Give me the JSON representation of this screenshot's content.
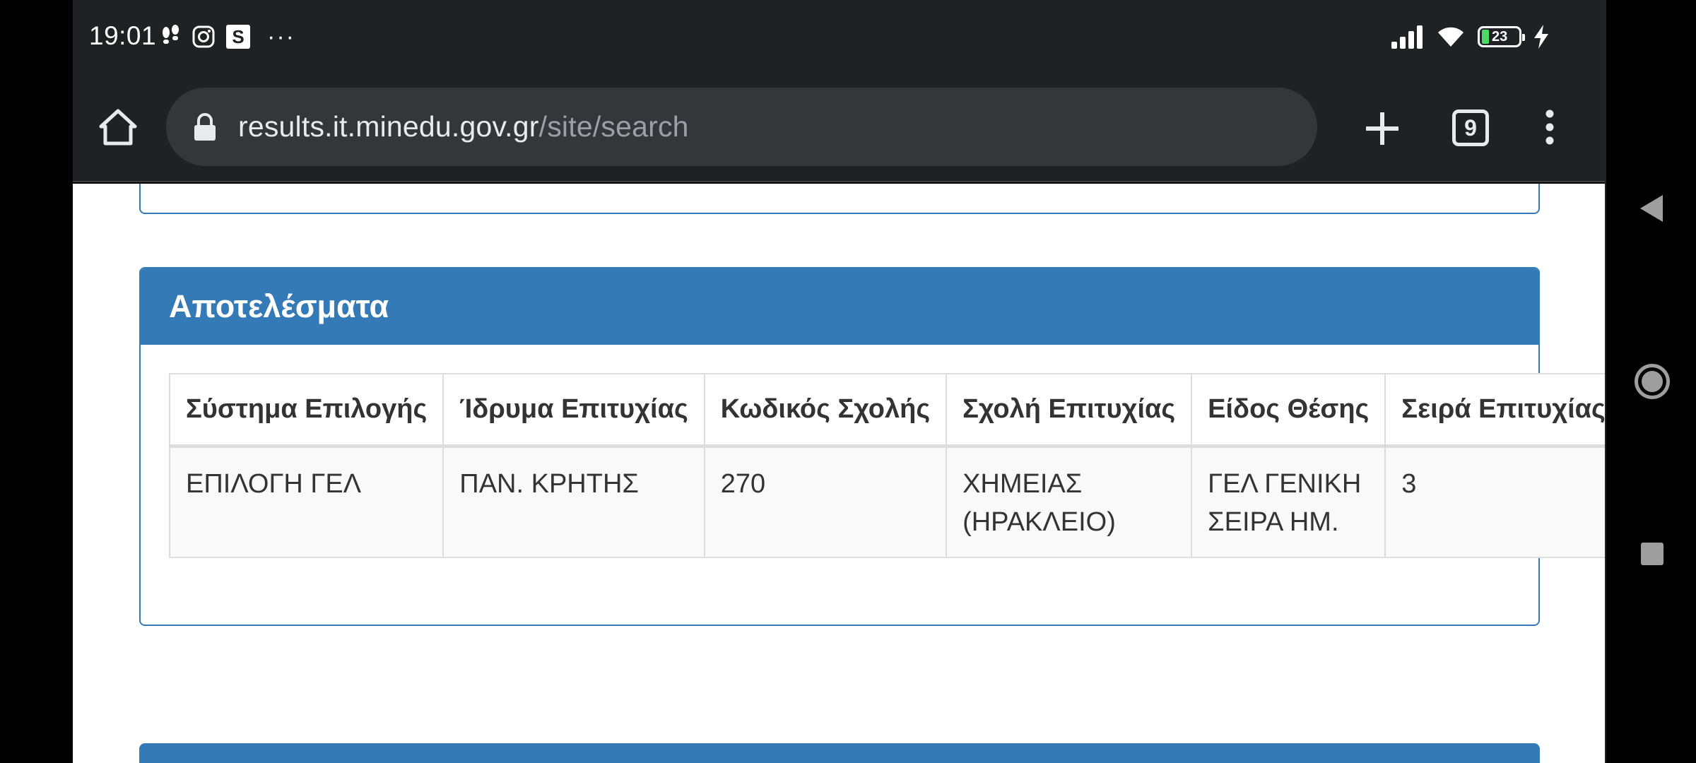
{
  "status": {
    "time": "19:01",
    "notif_icons": [
      "footsteps-icon",
      "instagram-icon",
      "s-app-icon",
      "more-dots-icon"
    ],
    "s_app_letter": "S",
    "more": "···",
    "battery": "23"
  },
  "browser": {
    "url_domain": "results.it.minedu.gov.gr",
    "url_path": "/site/search",
    "tab_count": "9"
  },
  "results": {
    "heading": "Αποτελέσματα",
    "columns": [
      "Σύστημα Επιλογής",
      "Ίδρυμα Επιτυχίας",
      "Κωδικός Σχολής",
      "Σχολή Επιτυχίας",
      "Είδος Θέσης",
      "Σειρά Επιτυχίας"
    ],
    "row": {
      "system": "ΕΠΙΛΟΓΗ ΓΕΛ",
      "institution": "ΠΑΝ. ΚΡΗΤΗΣ",
      "school_code": "270",
      "school_line1": "ΧΗΜΕΙΑΣ",
      "school_line2": "(ΗΡΑΚΛΕΙΟ)",
      "type_line1": "ΓΕΛ ΓΕΝΙΚΗ",
      "type_line2": "ΣΕΙΡΑ ΗΜ.",
      "rank": "3"
    }
  },
  "colors": {
    "primary": "#337ab7",
    "chrome_bg": "#202124",
    "urlbar_bg": "#35363a"
  }
}
